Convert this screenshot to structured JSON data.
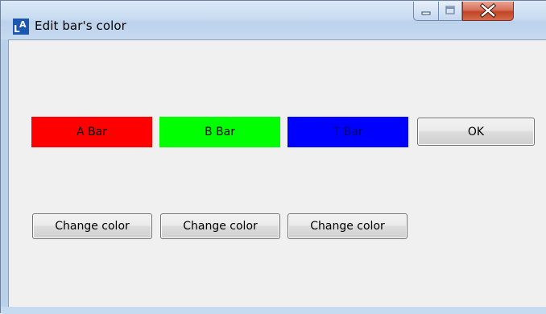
{
  "window": {
    "title": "Edit bar's color",
    "app_icon_letters": "LA",
    "controls": {
      "minimize": "minimize",
      "maximize": "maximize",
      "close": "close"
    }
  },
  "bars": [
    {
      "label": "A Bar",
      "color": "#ff0000",
      "text_color": "#000000"
    },
    {
      "label": "B Bar",
      "color": "#00ff00",
      "text_color": "#000000"
    },
    {
      "label": "T Bar",
      "color": "#0000ff",
      "text_color": "#000080"
    }
  ],
  "buttons": {
    "ok_label": "OK",
    "change_color_labels": [
      "Change color",
      "Change color",
      "Change color"
    ]
  },
  "colors": {
    "window_face": "#f0f0f0",
    "close_button": "#c24426"
  }
}
